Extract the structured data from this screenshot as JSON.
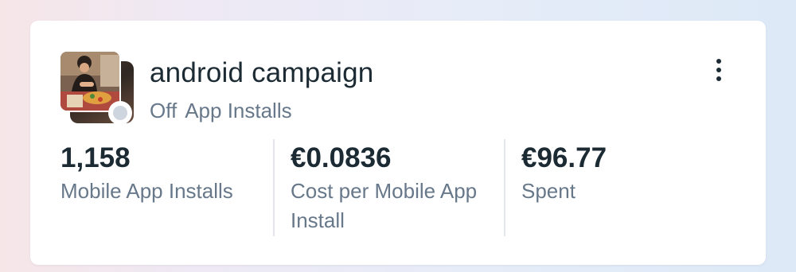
{
  "campaign": {
    "name": "android campaign",
    "status": "Off",
    "objective": "App Installs",
    "thumbnail_icon": "campaign-thumbnail",
    "status_color": "#cfd5de"
  },
  "metrics": [
    {
      "value": "1,158",
      "label": "Mobile App Installs"
    },
    {
      "value": "€0.0836",
      "label": "Cost per Mobile App Install"
    },
    {
      "value": "€96.77",
      "label": "Spent"
    }
  ],
  "menu": {
    "icon": "more-vertical-icon"
  },
  "colors": {
    "text_primary": "#1c2b33",
    "text_secondary": "#67788a",
    "card": "#ffffff"
  }
}
